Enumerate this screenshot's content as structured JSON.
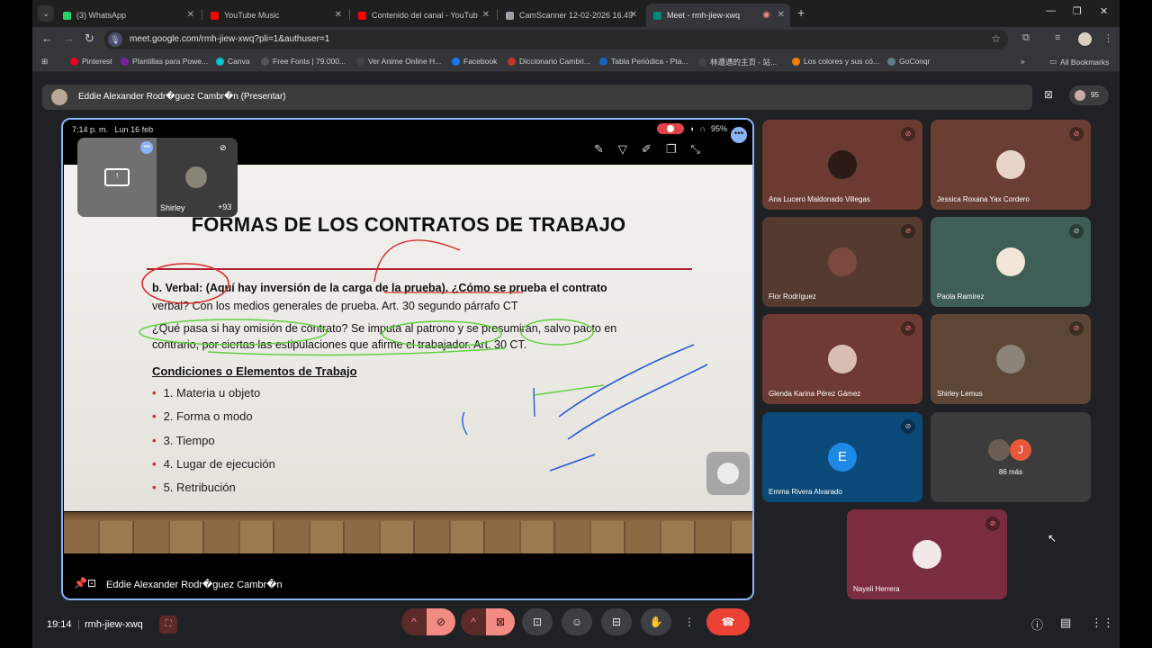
{
  "tabs": [
    {
      "title": "(3) WhatsApp",
      "color": "#25d366"
    },
    {
      "title": "YouTube Music",
      "color": "#ff0000"
    },
    {
      "title": "Contenido del canal - YouTube",
      "color": "#ff0000"
    },
    {
      "title": "CamScanner 12-02-2026 16.49",
      "color": "#9aa0a6"
    },
    {
      "title": "Meet - rmh-jiew-xwq",
      "color": "#00897b"
    }
  ],
  "omnibox": {
    "url": "meet.google.com/rmh-jiew-xwq?pli=1&authuser=1"
  },
  "bookmarks": [
    {
      "label": "Pinterest",
      "color": "#e60023"
    },
    {
      "label": "Plantillas para Powe...",
      "color": "#7b1fa2"
    },
    {
      "label": "Canva",
      "color": "#00c4cc"
    },
    {
      "label": "Free Fonts | 79.000...",
      "color": "#333333"
    },
    {
      "label": "Ver Anime Online H...",
      "color": "#444444"
    },
    {
      "label": "Facebook",
      "color": "#1877f2"
    },
    {
      "label": "Diccionario Cambri...",
      "color": "#c0392b"
    },
    {
      "label": "Tabla Periódica - Pta...",
      "color": "#1565c0"
    },
    {
      "label": "林遭遇的主页 - 站...",
      "color": "#444444"
    },
    {
      "label": "Los colores y sus có...",
      "color": "#f57c00"
    },
    {
      "label": "GoConqr",
      "color": "#607d8b"
    }
  ],
  "all_bookmarks": "All Bookmarks",
  "presenter_bar": {
    "label": "Eddie Alexander Rodr�guez Cambr�n (Presentar)"
  },
  "participants_count": "95",
  "stage": {
    "status_time": "7:14 p. m.",
    "status_date": "Lun 16 feb",
    "battery": "95%",
    "slide_title": "FORMAS DE LOS CONTRATOS DE TRABAJO",
    "line1": "b.  Verbal: (Aquí hay inversión de la carga de la prueba).  ¿Cómo se prueba el contrato",
    "line2": "verbal?  Con los medios generales de prueba.  Art. 30 segundo párrafo CT",
    "line3": "¿Qué pasa si hay omisión de contrato?  Se imputa al patrono y se presumirán, salvo pacto en",
    "line4": "contrario, por ciertas las estipulaciones que afirme el trabajador.  Art.  30 CT.",
    "conditions_heading": "Condiciones o Elementos de Trabajo",
    "conditions": [
      "1.  Materia u objeto",
      "2.  Forma o modo",
      "3.  Tiempo",
      "4.  Lugar de ejecución",
      "5.  Retribución"
    ],
    "self_name": "Shirley",
    "self_count": "+93",
    "presenter_name": "Eddie Alexander Rodr�guez Cambr�n"
  },
  "tiles": [
    {
      "name": "Ana Lucero Maldonado Villegas",
      "bg": "#6b3b32"
    },
    {
      "name": "Jessica Roxana Yax Cordero",
      "bg": "#6b3e34"
    },
    {
      "name": "Flor Rodríguez",
      "bg": "#553a30"
    },
    {
      "name": "Paola Ramirez",
      "bg": "#3f5e55"
    },
    {
      "name": "Glenda Karina Pérez Gámez",
      "bg": "#6e3a34"
    },
    {
      "name": "Shirley Lemus",
      "bg": "#5e4636"
    },
    {
      "name": "Emma Rivera Alvarado",
      "bg": "#0b4a78",
      "letter": "E"
    },
    {
      "name": "Nayeli Herrera",
      "bg": "#7a2d3e"
    }
  ],
  "more_tile": {
    "label": "86 más",
    "letter": "J"
  },
  "bottom": {
    "clock": "19:14",
    "code": "rmh-jiew-xwq"
  }
}
